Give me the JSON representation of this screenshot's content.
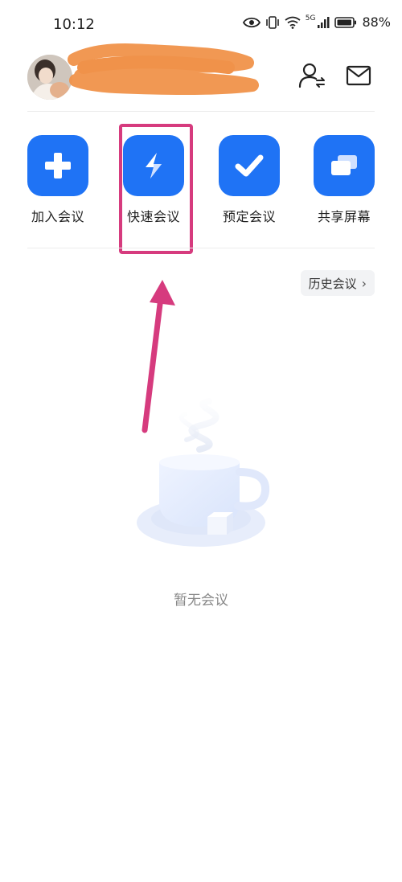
{
  "status": {
    "time": "10:12",
    "network": "5G",
    "battery": "88%"
  },
  "header": {
    "avatar_icon": "user-avatar",
    "switch_account_icon": "user-switch-icon",
    "mail_icon": "mail-icon"
  },
  "actions": [
    {
      "label": "加入会议",
      "icon": "plus-icon"
    },
    {
      "label": "快速会议",
      "icon": "lightning-icon"
    },
    {
      "label": "预定会议",
      "icon": "check-icon"
    },
    {
      "label": "共享屏幕",
      "icon": "screen-share-icon"
    }
  ],
  "history_button": {
    "label": "历史会议"
  },
  "empty_state": {
    "text": "暂无会议",
    "illustration": "coffee-cup-illustration"
  },
  "colors": {
    "accent": "#1f73f5",
    "highlight": "#d63b7e",
    "scribble": "#f0924a"
  }
}
